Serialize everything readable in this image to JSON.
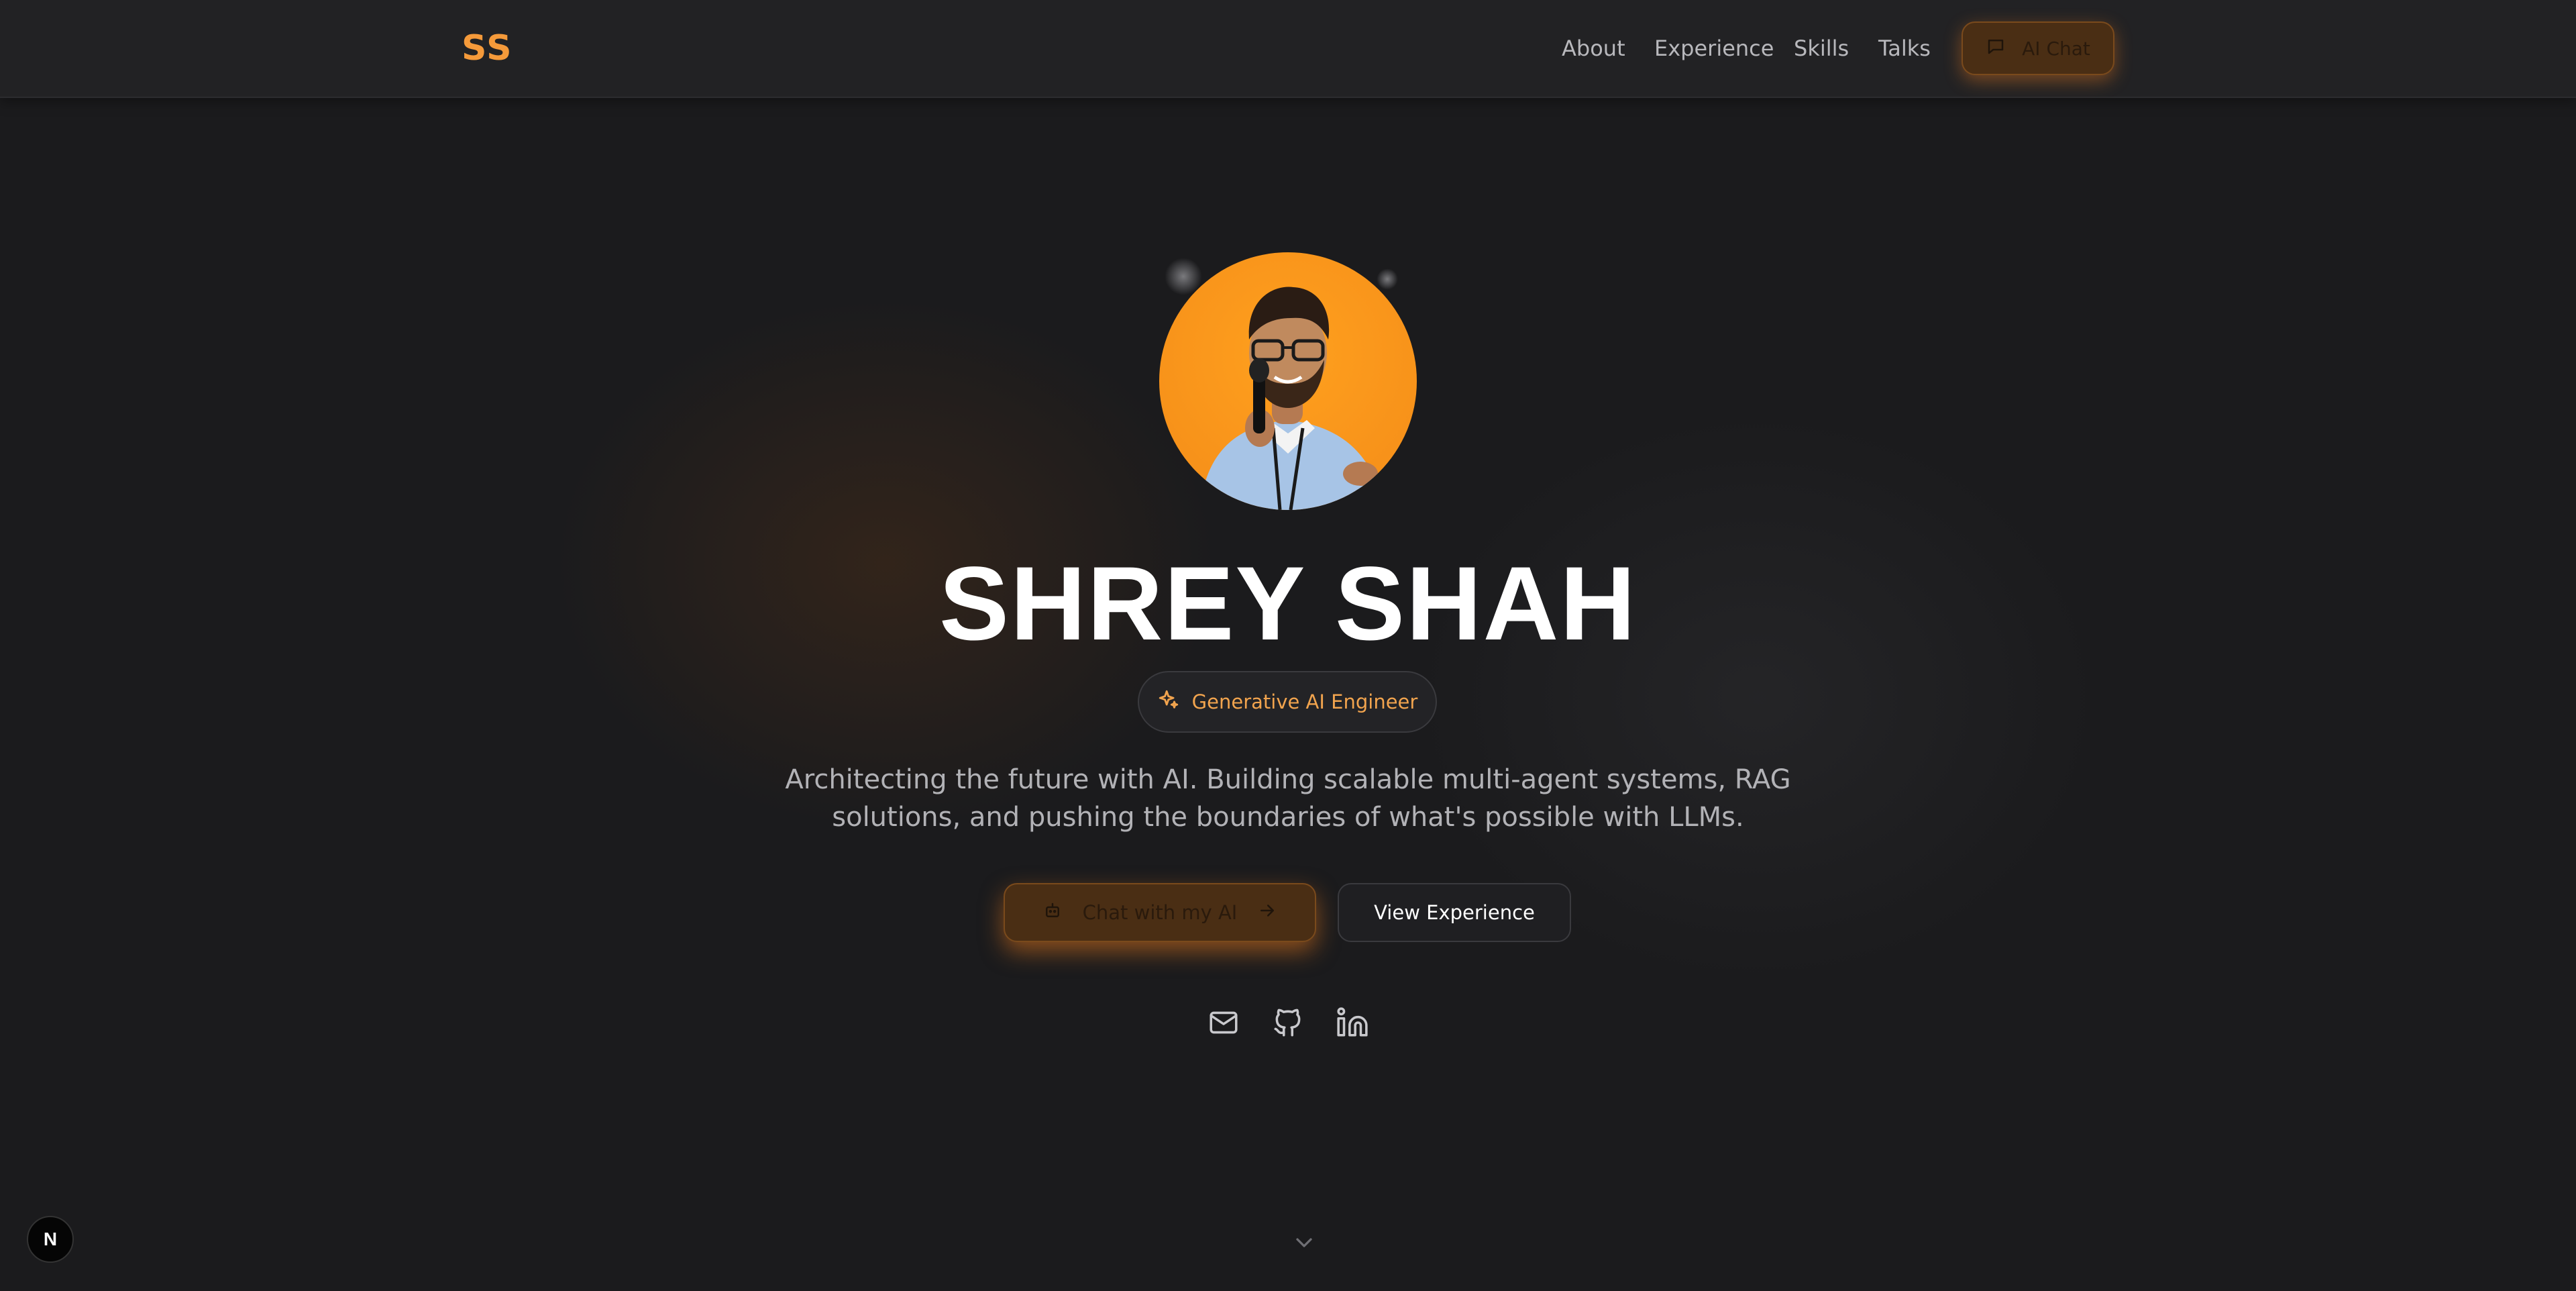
{
  "header": {
    "logo": "SS",
    "nav": [
      "About",
      "Experience",
      "Skills",
      "Talks"
    ],
    "ai_chat_label": "AI Chat"
  },
  "hero": {
    "name": "SHREY SHAH",
    "role": "Generative AI Engineer",
    "tagline_line1": "Architecting the future with AI. Building scalable multi-agent systems, RAG",
    "tagline_line2": "solutions, and pushing the boundaries of what's possible with LLMs.",
    "primary_cta": "Chat with my AI",
    "secondary_cta": "View Experience"
  },
  "social": [
    "mail-icon",
    "github-icon",
    "linkedin-icon"
  ],
  "badge": "N",
  "colors": {
    "accent": "#f59a3a",
    "background": "#1b1b1d",
    "avatar_bg": "#f7921a"
  }
}
